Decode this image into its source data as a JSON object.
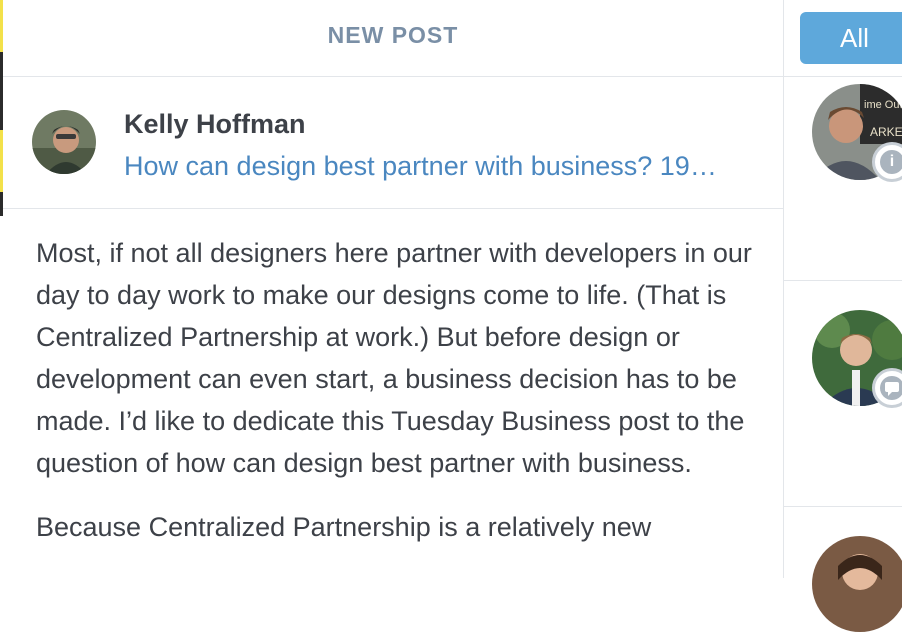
{
  "header": {
    "new_post_label": "NEW POST"
  },
  "filter": {
    "all_label": "All"
  },
  "post": {
    "author_name": "Kelly Hoffman",
    "title": "How can design best partner with business? 19…",
    "paragraphs": [
      "Most, if not all designers here partner with developers in our day to day work to make our designs come to life. (That is Centralized Partnership at work.) But before design or development can even start, a business decision has to be made. I’d like to dedicate this Tuesday Business post to the question of how can design best partner with business.",
      "Because Centralized Partnership is a relatively new"
    ]
  },
  "icons": {
    "info_badge": "info-icon",
    "comment_badge": "comment-icon"
  },
  "colors": {
    "accent": "#5ea8db",
    "link": "#4a87c0",
    "header_text": "#7a8fa6"
  }
}
